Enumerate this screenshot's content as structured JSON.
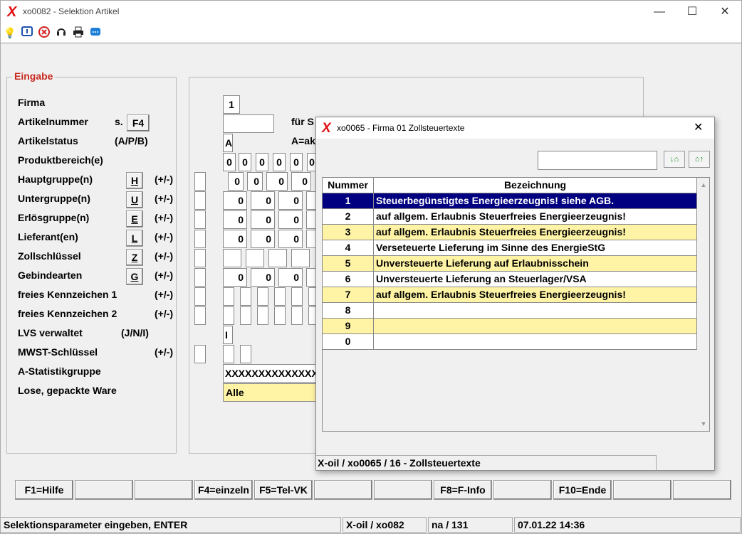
{
  "window": {
    "title": "xo0082 - Selektion Artikel",
    "minimize": "—",
    "maximize": "☐",
    "close": "✕"
  },
  "toolbar": {
    "icons": [
      "lightbulb-icon",
      "info-icon",
      "cancel-icon",
      "support-icon",
      "printer-icon",
      "chat-icon"
    ]
  },
  "form": {
    "legend": "Eingabe",
    "labels": [
      "Firma",
      "Artikelnummer",
      "Artikelstatus",
      "Produktbereich(e)",
      "Hauptgruppe(n)",
      "Untergruppe(n)",
      "Erlösgruppe(n)",
      "Lieferant(en)",
      "Zollschlüssel",
      "Gebindearten",
      "freies Kennzeichen 1",
      "freies Kennzeichen 2",
      "LVS verwaltet",
      "MWST-Schlüssel",
      "A-Statistikgruppe",
      "Lose, gepackte Ware"
    ],
    "artnr_hint": "s.",
    "artnr_button": "F4",
    "status_hint": "(A/P/B)",
    "lvs_hint": "(J/N/I)",
    "buttons": {
      "h": "H",
      "u": "U",
      "e": "E",
      "l": "L",
      "z": "Z",
      "g": "G"
    },
    "pm": "(+/-)",
    "firma_value": "1",
    "fuer_label": "für S",
    "status_value": "A",
    "status_text": "A=ak",
    "zero": "0",
    "lvs_value": "I",
    "statistik_value": "XXXXXXXXXXXXXX",
    "lose_value": "Alle"
  },
  "dialog": {
    "title": "xo0065 - Firma 01 Zollsteuertexte",
    "close": "✕",
    "search_value": "",
    "search_down_icon": "↓⌂",
    "search_up_icon": "⌂↑",
    "col_nummer": "Nummer",
    "col_bezeichnung": "Bezeichnung",
    "rows": [
      {
        "nr": "1",
        "text": "Steuerbegünstigtes Energieerzeugnis! siehe AGB."
      },
      {
        "nr": "2",
        "text": "auf allgem. Erlaubnis Steuerfreies Energieerzeugnis!"
      },
      {
        "nr": "3",
        "text": "auf allgem. Erlaubnis Steuerfreies Energieerzeugnis!"
      },
      {
        "nr": "4",
        "text": "Verseteuerte Lieferung im Sinne des EnergieStG"
      },
      {
        "nr": "5",
        "text": "Unversteuerte Lieferung auf Erlaubnisschein"
      },
      {
        "nr": "6",
        "text": "Unversteuerte Lieferung an Steuerlager/VSA"
      },
      {
        "nr": "7",
        "text": "auf allgem. Erlaubnis Steuerfreies Energieerzeugnis!"
      },
      {
        "nr": "8",
        "text": ""
      },
      {
        "nr": "9",
        "text": ""
      },
      {
        "nr": "0",
        "text": ""
      }
    ],
    "status": "X-oil / xo0065 / 16 - Zollsteuertexte"
  },
  "fkeys": [
    "F1=Hilfe",
    "",
    "",
    "F4=einzeln",
    "F5=Tel-VK",
    "",
    "",
    "F8=F-Info",
    "",
    "F10=Ende",
    "",
    ""
  ],
  "statusbar": {
    "message": "Selektionsparameter eingeben, ENTER",
    "program": "X-oil / xo082",
    "user": "na / 131",
    "datetime": "07.01.22 14:36"
  },
  "colors": {
    "selected": "#000080",
    "highlight": "#fff4a6",
    "legend": "#c8281e",
    "logo": "#e01010"
  }
}
